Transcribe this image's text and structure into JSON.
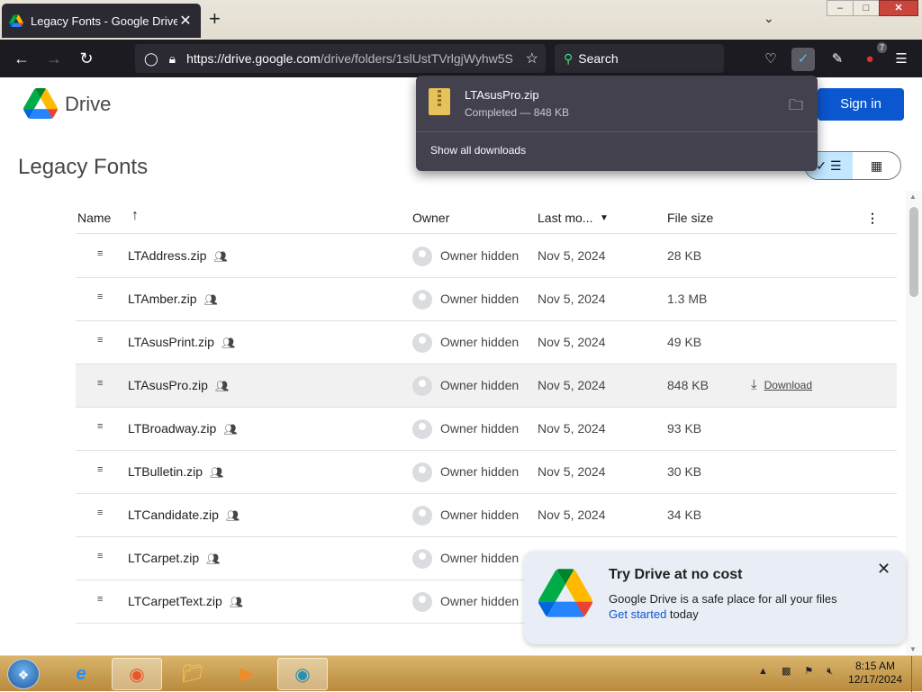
{
  "browser": {
    "tab_title": "Legacy Fonts - Google Drive",
    "tab_close": "✕",
    "new_tab": "+",
    "url_host": "https://drive.google.com",
    "url_path": "/drive/folders/1slUstTVrlgjWyhw5S",
    "search_placeholder": "Search",
    "extension_badge": "7"
  },
  "downloads_panel": {
    "file_name": "LTAsusPro.zip",
    "status": "Completed — 848 KB",
    "show_all": "Show all downloads"
  },
  "drive": {
    "brand": "Drive",
    "sign_in": "Sign in",
    "folder_title": "Legacy Fonts",
    "columns": {
      "name": "Name",
      "owner": "Owner",
      "modified": "Last mo...",
      "size": "File size"
    },
    "download_label": "Download"
  },
  "files": [
    {
      "name": "LTAddress.zip",
      "owner": "Owner hidden",
      "modified": "Nov 5, 2024",
      "size": "28 KB"
    },
    {
      "name": "LTAmber.zip",
      "owner": "Owner hidden",
      "modified": "Nov 5, 2024",
      "size": "1.3 MB"
    },
    {
      "name": "LTAsusPrint.zip",
      "owner": "Owner hidden",
      "modified": "Nov 5, 2024",
      "size": "49 KB"
    },
    {
      "name": "LTAsusPro.zip",
      "owner": "Owner hidden",
      "modified": "Nov 5, 2024",
      "size": "848 KB"
    },
    {
      "name": "LTBroadway.zip",
      "owner": "Owner hidden",
      "modified": "Nov 5, 2024",
      "size": "93 KB"
    },
    {
      "name": "LTBulletin.zip",
      "owner": "Owner hidden",
      "modified": "Nov 5, 2024",
      "size": "30 KB"
    },
    {
      "name": "LTCandidate.zip",
      "owner": "Owner hidden",
      "modified": "Nov 5, 2024",
      "size": "34 KB"
    },
    {
      "name": "LTCarpet.zip",
      "owner": "Owner hidden",
      "modified": "",
      "size": ""
    },
    {
      "name": "LTCarpetText.zip",
      "owner": "Owner hidden",
      "modified": "",
      "size": ""
    }
  ],
  "promo": {
    "title": "Try Drive at no cost",
    "body": "Google Drive is a safe place for all your files",
    "link": "Get started",
    "suffix": " today"
  },
  "taskbar": {
    "time": "8:15 AM",
    "date": "12/17/2024"
  },
  "colors": {
    "accent": "#0b57d0",
    "browser_dark": "#1c1b22",
    "panel": "#42414d",
    "promo_bg": "#e9eef6",
    "taskbar": "#c79a4a"
  }
}
